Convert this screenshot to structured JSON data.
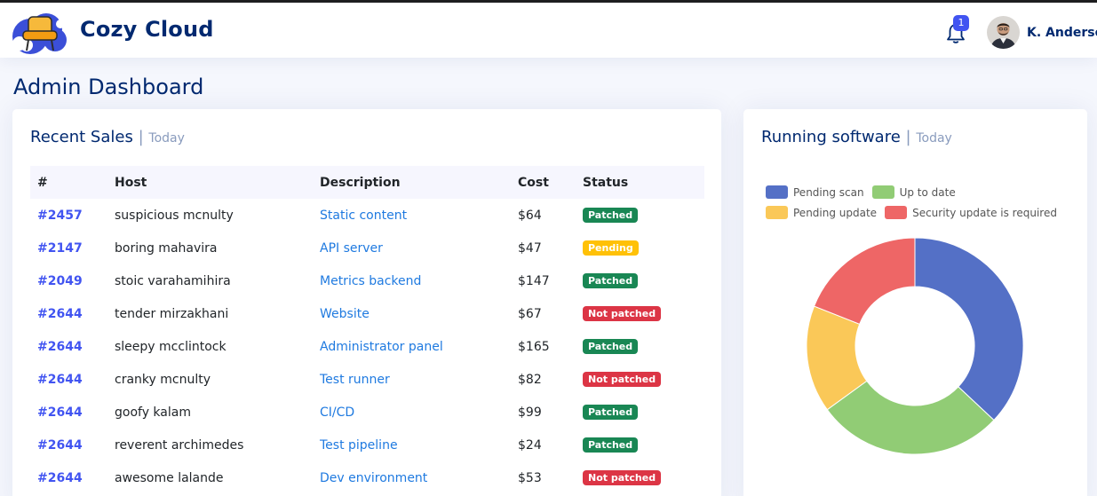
{
  "app": {
    "name": "Cozy Cloud",
    "notification_count": "1",
    "user_name": "K. Anderson"
  },
  "page": {
    "title": "Admin Dashboard"
  },
  "sales": {
    "title": "Recent Sales",
    "separator": "|",
    "filter": "Today",
    "columns": [
      "#",
      "Host",
      "Description",
      "Cost",
      "Status"
    ],
    "rows": [
      {
        "id": "#2457",
        "host": "suspicious mcnulty",
        "description": "Static content",
        "cost": "$64",
        "status": "Patched",
        "status_kind": "patched"
      },
      {
        "id": "#2147",
        "host": "boring mahavira",
        "description": "API server",
        "cost": "$47",
        "status": "Pending",
        "status_kind": "pending"
      },
      {
        "id": "#2049",
        "host": "stoic varahamihira",
        "description": "Metrics backend",
        "cost": "$147",
        "status": "Patched",
        "status_kind": "patched"
      },
      {
        "id": "#2644",
        "host": "tender mirzakhani",
        "description": "Website",
        "cost": "$67",
        "status": "Not patched",
        "status_kind": "notpatched"
      },
      {
        "id": "#2644",
        "host": "sleepy mcclintock",
        "description": "Administrator panel",
        "cost": "$165",
        "status": "Patched",
        "status_kind": "patched"
      },
      {
        "id": "#2644",
        "host": "cranky mcnulty",
        "description": "Test runner",
        "cost": "$82",
        "status": "Not patched",
        "status_kind": "notpatched"
      },
      {
        "id": "#2644",
        "host": "goofy kalam",
        "description": "CI/CD",
        "cost": "$99",
        "status": "Patched",
        "status_kind": "patched"
      },
      {
        "id": "#2644",
        "host": "reverent archimedes",
        "description": "Test pipeline",
        "cost": "$24",
        "status": "Patched",
        "status_kind": "patched"
      },
      {
        "id": "#2644",
        "host": "awesome lalande",
        "description": "Dev environment",
        "cost": "$53",
        "status": "Not patched",
        "status_kind": "notpatched"
      }
    ]
  },
  "software": {
    "title": "Running software",
    "separator": "|",
    "filter": "Today",
    "chart_data": {
      "type": "pie",
      "style": "donut",
      "categories": [
        "Pending scan",
        "Up to date",
        "Pending update",
        "Security update is required"
      ],
      "values": [
        37,
        28,
        16,
        19
      ],
      "colors": [
        "#5470c6",
        "#91cc75",
        "#fac858",
        "#ee6666"
      ],
      "legend_position": "top"
    }
  },
  "colors": {
    "brand": "#012970",
    "accent": "#4154f1",
    "patched": "#198754",
    "pending": "#ffc107",
    "not_patched": "#dc3545"
  },
  "icons": {
    "logo": "cloud-chair-logo",
    "notifications": "bell-icon",
    "user": "avatar"
  }
}
